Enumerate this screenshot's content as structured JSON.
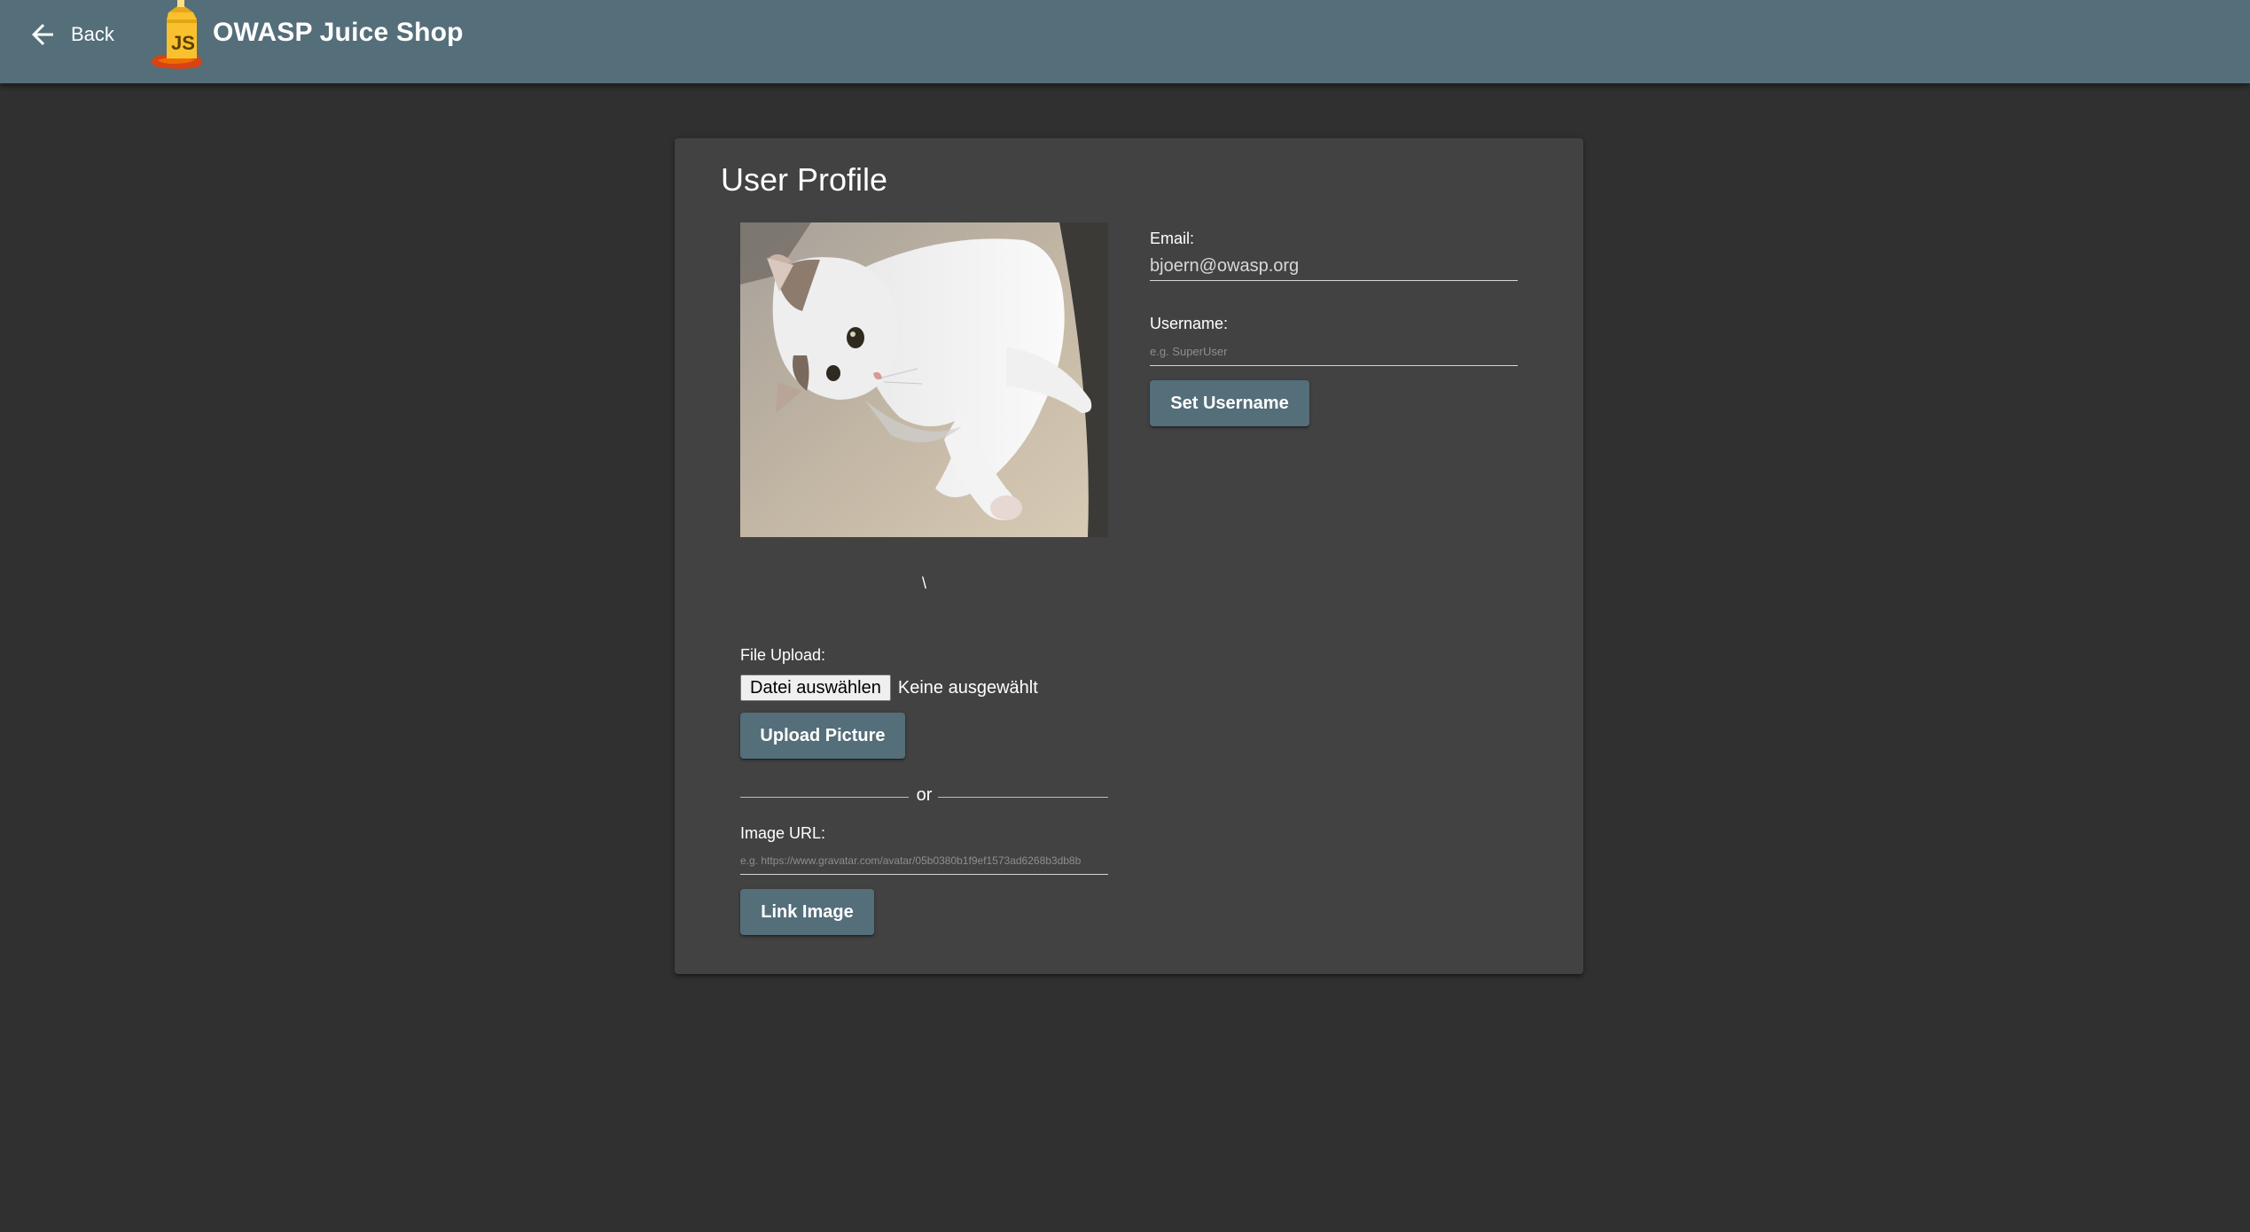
{
  "toolbar": {
    "back_label": "Back",
    "app_title": "OWASP Juice Shop"
  },
  "profile": {
    "title": "User Profile",
    "image_caption": "\\",
    "file_upload_label": "File Upload:",
    "file_choose_label": "Datei auswählen",
    "file_status": "Keine ausgewählt",
    "upload_button": "Upload Picture",
    "divider_text": "or",
    "image_url_label": "Image URL:",
    "image_url_placeholder": "e.g. https://www.gravatar.com/avatar/05b0380b1f9ef1573ad6268b3db8b",
    "link_button": "Link Image",
    "email_label": "Email:",
    "email_value": "bjoern@owasp.org",
    "username_label": "Username:",
    "username_placeholder": "e.g. SuperUser",
    "set_username_button": "Set Username"
  },
  "colors": {
    "toolbar": "#546e7a",
    "background": "#303030",
    "card": "#424242",
    "button": "#546e7a"
  }
}
